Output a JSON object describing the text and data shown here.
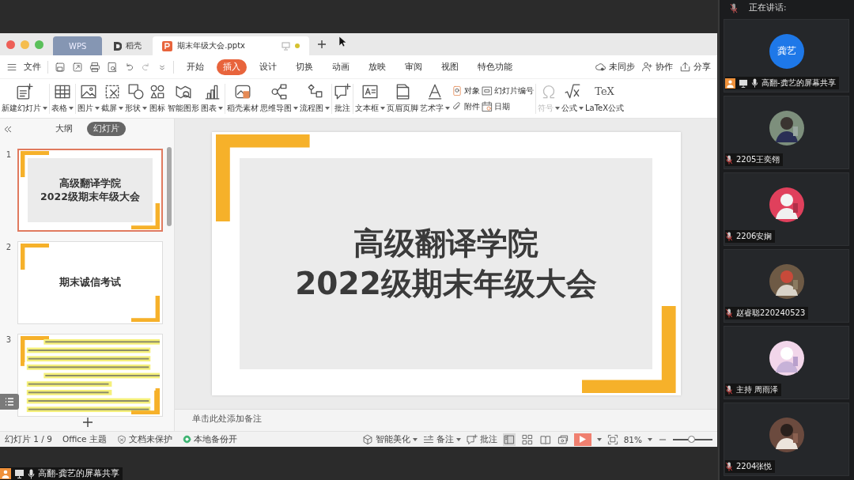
{
  "window_tabs": [
    {
      "label": "WPS",
      "kind": "home",
      "selected": false
    },
    {
      "label": "稻壳",
      "kind": "docer",
      "selected": false
    },
    {
      "label": "期末年级大会.pptx",
      "kind": "presentation",
      "selected": true
    }
  ],
  "menu": {
    "file_label": "文件",
    "tabs": [
      {
        "label": "开始",
        "selected": false
      },
      {
        "label": "插入",
        "selected": true
      },
      {
        "label": "设计",
        "selected": false
      },
      {
        "label": "切换",
        "selected": false
      },
      {
        "label": "动画",
        "selected": false
      },
      {
        "label": "放映",
        "selected": false
      },
      {
        "label": "审阅",
        "selected": false
      },
      {
        "label": "视图",
        "selected": false
      },
      {
        "label": "特色功能",
        "selected": false
      }
    ],
    "actions": [
      {
        "label": "未同步"
      },
      {
        "label": "协作"
      },
      {
        "label": "分享"
      }
    ]
  },
  "ribbon": {
    "groups": [
      [
        {
          "kind": "large",
          "label": "新建幻灯片",
          "dropdown": true,
          "disabled": false
        }
      ],
      [
        {
          "kind": "large",
          "label": "表格",
          "dropdown": true,
          "disabled": false
        }
      ],
      [
        {
          "kind": "large",
          "label": "图片",
          "dropdown": true,
          "disabled": false
        },
        {
          "kind": "large",
          "label": "截屏",
          "dropdown": true,
          "disabled": false
        },
        {
          "kind": "large",
          "label": "形状",
          "dropdown": true,
          "disabled": false
        },
        {
          "kind": "large",
          "label": "图标",
          "dropdown": false,
          "disabled": false
        },
        {
          "kind": "large",
          "label": "智能图形",
          "dropdown": false,
          "disabled": false
        },
        {
          "kind": "large",
          "label": "图表",
          "dropdown": true,
          "disabled": false
        }
      ],
      [
        {
          "kind": "large",
          "label": "稻壳素材",
          "dropdown": false,
          "disabled": false
        },
        {
          "kind": "large",
          "label": "思维导图",
          "dropdown": true,
          "disabled": false
        },
        {
          "kind": "large",
          "label": "流程图",
          "dropdown": true,
          "disabled": false
        }
      ],
      [
        {
          "kind": "large",
          "label": "批注",
          "dropdown": false,
          "disabled": false
        }
      ],
      [
        {
          "kind": "large",
          "label": "文本框",
          "dropdown": true,
          "disabled": false
        },
        {
          "kind": "large",
          "label": "页眉页脚",
          "dropdown": false,
          "disabled": false
        },
        {
          "kind": "large",
          "label": "艺术字",
          "dropdown": true,
          "disabled": false
        },
        {
          "kind": "stack",
          "items": [
            {
              "label": "对象",
              "disabled": false
            },
            {
              "label": "附件",
              "disabled": false
            }
          ]
        },
        {
          "kind": "stack",
          "items": [
            {
              "label": "幻灯片编号",
              "disabled": false
            },
            {
              "label": "日期",
              "disabled": false
            }
          ]
        }
      ],
      [
        {
          "kind": "large",
          "label": "符号",
          "dropdown": true,
          "disabled": true
        },
        {
          "kind": "large",
          "label": "公式",
          "dropdown": true,
          "disabled": false
        },
        {
          "kind": "large",
          "label": "LaTeX公式",
          "glyph": "TeX",
          "dropdown": false,
          "disabled": false
        }
      ]
    ]
  },
  "slide_panel": {
    "view_tabs": [
      {
        "label": "大纲",
        "selected": false
      },
      {
        "label": "幻灯片",
        "selected": true
      }
    ],
    "slides": [
      {
        "number": "1",
        "kind": "title-boxed",
        "lines": [
          "高级翻译学院",
          "2022级期末年级大会"
        ],
        "selected": true
      },
      {
        "number": "2",
        "kind": "title",
        "lines": [
          "期末诚信考试"
        ],
        "selected": false
      },
      {
        "number": "3",
        "kind": "document",
        "selected": false
      }
    ]
  },
  "current_slide": {
    "kind": "title-boxed",
    "lines": [
      "高级翻译学院",
      "2022级期末年级大会"
    ]
  },
  "notes_placeholder": "单击此处添加备注",
  "status_bar": {
    "left": [
      {
        "label": "幻灯片 1 / 9"
      },
      {
        "label": "Office 主题"
      },
      {
        "label": "文档未保护"
      },
      {
        "label": "本地备份开"
      }
    ],
    "tools": [
      {
        "label": "智能美化",
        "dropdown": true
      },
      {
        "label": "备注",
        "dropdown": true
      },
      {
        "label": "批注",
        "dropdown": false
      }
    ],
    "views": [
      {
        "kind": "normal",
        "selected": true
      },
      {
        "kind": "sorter",
        "selected": false
      },
      {
        "kind": "reading",
        "selected": false
      }
    ],
    "zoom": "81%",
    "zoom_slider": {
      "level": 0.45
    }
  },
  "share_label": {
    "text": "高翻-龚艺的屏幕共享"
  },
  "meeting": {
    "speaking_label": "正在讲话:",
    "participants": [
      {
        "name": "高翻-龚艺的屏幕共享",
        "avatar_text": "龚艺",
        "sharing": true,
        "muted": false
      },
      {
        "name": "2205王奕翎",
        "sharing": false,
        "muted": true
      },
      {
        "name": "2206安娴",
        "sharing": false,
        "muted": true
      },
      {
        "name": "赵睿聪220240523",
        "sharing": false,
        "muted": true
      },
      {
        "name": "主持 周雨泽",
        "sharing": false,
        "muted": true
      },
      {
        "name": "2204张悦",
        "sharing": false,
        "muted": true
      }
    ]
  }
}
